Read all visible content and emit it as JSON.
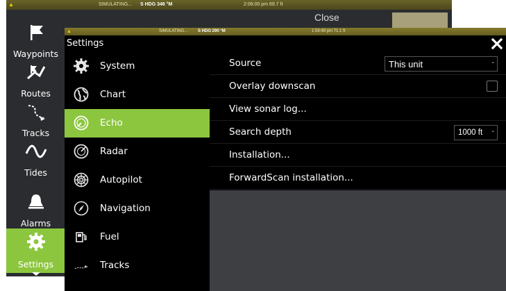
{
  "background_screen": {
    "status_bar": {
      "warning_icon": "warning-triangle-icon",
      "simulating": "SIMULATING...",
      "heading": "S HDG 346 °M",
      "time": "2:06:00 pm  69.7 ft"
    },
    "close_label": "Close",
    "sidebar": {
      "items": [
        {
          "label": "Waypoints",
          "icon": "waypoint-flag-icon"
        },
        {
          "label": "Routes",
          "icon": "route-icon"
        },
        {
          "label": "Tracks",
          "icon": "track-icon"
        },
        {
          "label": "Tides",
          "icon": "tide-wave-icon"
        },
        {
          "label": "Alarms",
          "icon": "alarm-bell-icon"
        },
        {
          "label": "Settings",
          "icon": "gear-icon",
          "active": true
        }
      ]
    }
  },
  "dialog": {
    "status_bar": {
      "warning_icon": "warning-triangle-icon",
      "simulating": "SIMULATING...",
      "heading": "S HDG 290 °M",
      "time": "1:59:49 pm  71.1 ft"
    },
    "title": "Settings",
    "close_icon": "close-icon",
    "menu": [
      {
        "label": "System",
        "icon": "gear-icon"
      },
      {
        "label": "Chart",
        "icon": "globe-icon"
      },
      {
        "label": "Echo",
        "icon": "echo-gauge-icon",
        "active": true
      },
      {
        "label": "Radar",
        "icon": "radar-icon"
      },
      {
        "label": "Autopilot",
        "icon": "helm-wheel-icon"
      },
      {
        "label": "Navigation",
        "icon": "compass-icon"
      },
      {
        "label": "Fuel",
        "icon": "fuel-pump-icon"
      },
      {
        "label": "Tracks",
        "icon": "track-icon"
      }
    ],
    "echo_settings": {
      "source": {
        "label": "Source",
        "value": "This unit"
      },
      "overlay_downscan": {
        "label": "Overlay downscan",
        "checked": false
      },
      "view_sonar_log": {
        "label": "View sonar log..."
      },
      "search_depth": {
        "label": "Search depth",
        "value": "1000 ft"
      },
      "installation": {
        "label": "Installation..."
      },
      "forwardscan_installation": {
        "label": "ForwardScan installation..."
      }
    }
  },
  "colors": {
    "accent": "#8cc63f",
    "status_bar": "#645c20",
    "panel": "#000000",
    "empty_area": "#3d3f43"
  }
}
